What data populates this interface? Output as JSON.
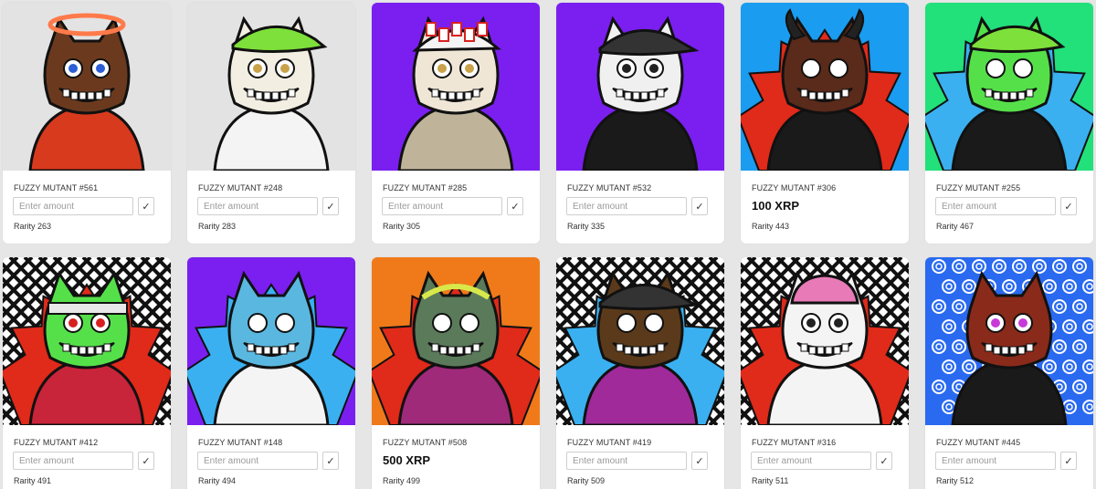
{
  "cards": [
    {
      "name": "FUZZY MUTANT #561",
      "placeholder": "Enter amount",
      "check": "✓",
      "price": "",
      "rarity": "Rarity 263",
      "bg": "#e3e3e3",
      "pattern": "plain",
      "fur": "#6b3a1e",
      "body": "#d83a1e",
      "eye": "#2c5fd6",
      "hat": "halo"
    },
    {
      "name": "FUZZY MUTANT #248",
      "placeholder": "Enter amount",
      "check": "✓",
      "price": "",
      "rarity": "Rarity 283",
      "bg": "#e3e3e3",
      "pattern": "plain",
      "fur": "#f2eee2",
      "body": "#f4f4f4",
      "eye": "#c9a24a",
      "hat": "cap-green"
    },
    {
      "name": "FUZZY MUTANT #285",
      "placeholder": "Enter amount",
      "check": "✓",
      "price": "",
      "rarity": "Rarity 305",
      "bg": "#7a1ff0",
      "pattern": "plain",
      "fur": "#efe6d6",
      "body": "#bfb49a",
      "eye": "#c9a24a",
      "hat": "cards"
    },
    {
      "name": "FUZZY MUTANT #532",
      "placeholder": "Enter amount",
      "check": "✓",
      "price": "",
      "rarity": "Rarity 335",
      "bg": "#7a1ff0",
      "pattern": "plain",
      "fur": "#f0f0f0",
      "body": "#1a1a1a",
      "eye": "#222222",
      "hat": "cap-dark"
    },
    {
      "name": "FUZZY MUTANT #306",
      "placeholder": "",
      "check": "",
      "price": "100 XRP",
      "rarity": "Rarity 443",
      "bg": "#1a9cf0",
      "pattern": "flames-red",
      "fur": "#5a2a1a",
      "body": "#1a1a1a",
      "eye": "#ffffff",
      "hat": "horns"
    },
    {
      "name": "FUZZY MUTANT #255",
      "placeholder": "Enter amount",
      "check": "✓",
      "price": "",
      "rarity": "Rarity 467",
      "bg": "#22e07a",
      "pattern": "flames-blue",
      "fur": "#55e04a",
      "body": "#1a1a1a",
      "eye": "#ffffff",
      "hat": "cap-green"
    },
    {
      "name": "FUZZY MUTANT #412",
      "placeholder": "Enter amount",
      "check": "✓",
      "price": "",
      "rarity": "Rarity 491",
      "bg": "#ffffff",
      "pattern": "lattice-red",
      "fur": "#55e04a",
      "body": "#c8243a",
      "eye": "#d82020",
      "hat": "band"
    },
    {
      "name": "FUZZY MUTANT #148",
      "placeholder": "Enter amount",
      "check": "✓",
      "price": "",
      "rarity": "Rarity 494",
      "bg": "#7a1ff0",
      "pattern": "flames-blue",
      "fur": "#5ab8e0",
      "body": "#f4f4f4",
      "eye": "#ffffff",
      "hat": "none"
    },
    {
      "name": "FUZZY MUTANT #508",
      "placeholder": "",
      "check": "",
      "price": "500 XRP",
      "rarity": "Rarity 499",
      "bg": "#f07a1a",
      "pattern": "flames-red",
      "fur": "#5a7a5a",
      "body": "#a02a7a",
      "eye": "#ffffff",
      "hat": "laurel"
    },
    {
      "name": "FUZZY MUTANT #419",
      "placeholder": "Enter amount",
      "check": "✓",
      "price": "",
      "rarity": "Rarity 509",
      "bg": "#ffffff",
      "pattern": "lattice-blue",
      "fur": "#5a3a1a",
      "body": "#a02a9a",
      "eye": "#ffffff",
      "hat": "cap-dark"
    },
    {
      "name": "FUZZY MUTANT #316",
      "placeholder": "Enter amount",
      "check": "✓",
      "price": "",
      "rarity": "Rarity 511",
      "bg": "#ffffff",
      "pattern": "lattice-red",
      "fur": "#f4f4f4",
      "body": "#f4f4f4",
      "eye": "#222222",
      "hat": "brain"
    },
    {
      "name": "FUZZY MUTANT #445",
      "placeholder": "Enter amount",
      "check": "✓",
      "price": "",
      "rarity": "Rarity 512",
      "bg": "#2a6af0",
      "pattern": "swirl",
      "fur": "#8a2a1a",
      "body": "#1a1a1a",
      "eye": "#c83ad8",
      "hat": "none"
    }
  ]
}
